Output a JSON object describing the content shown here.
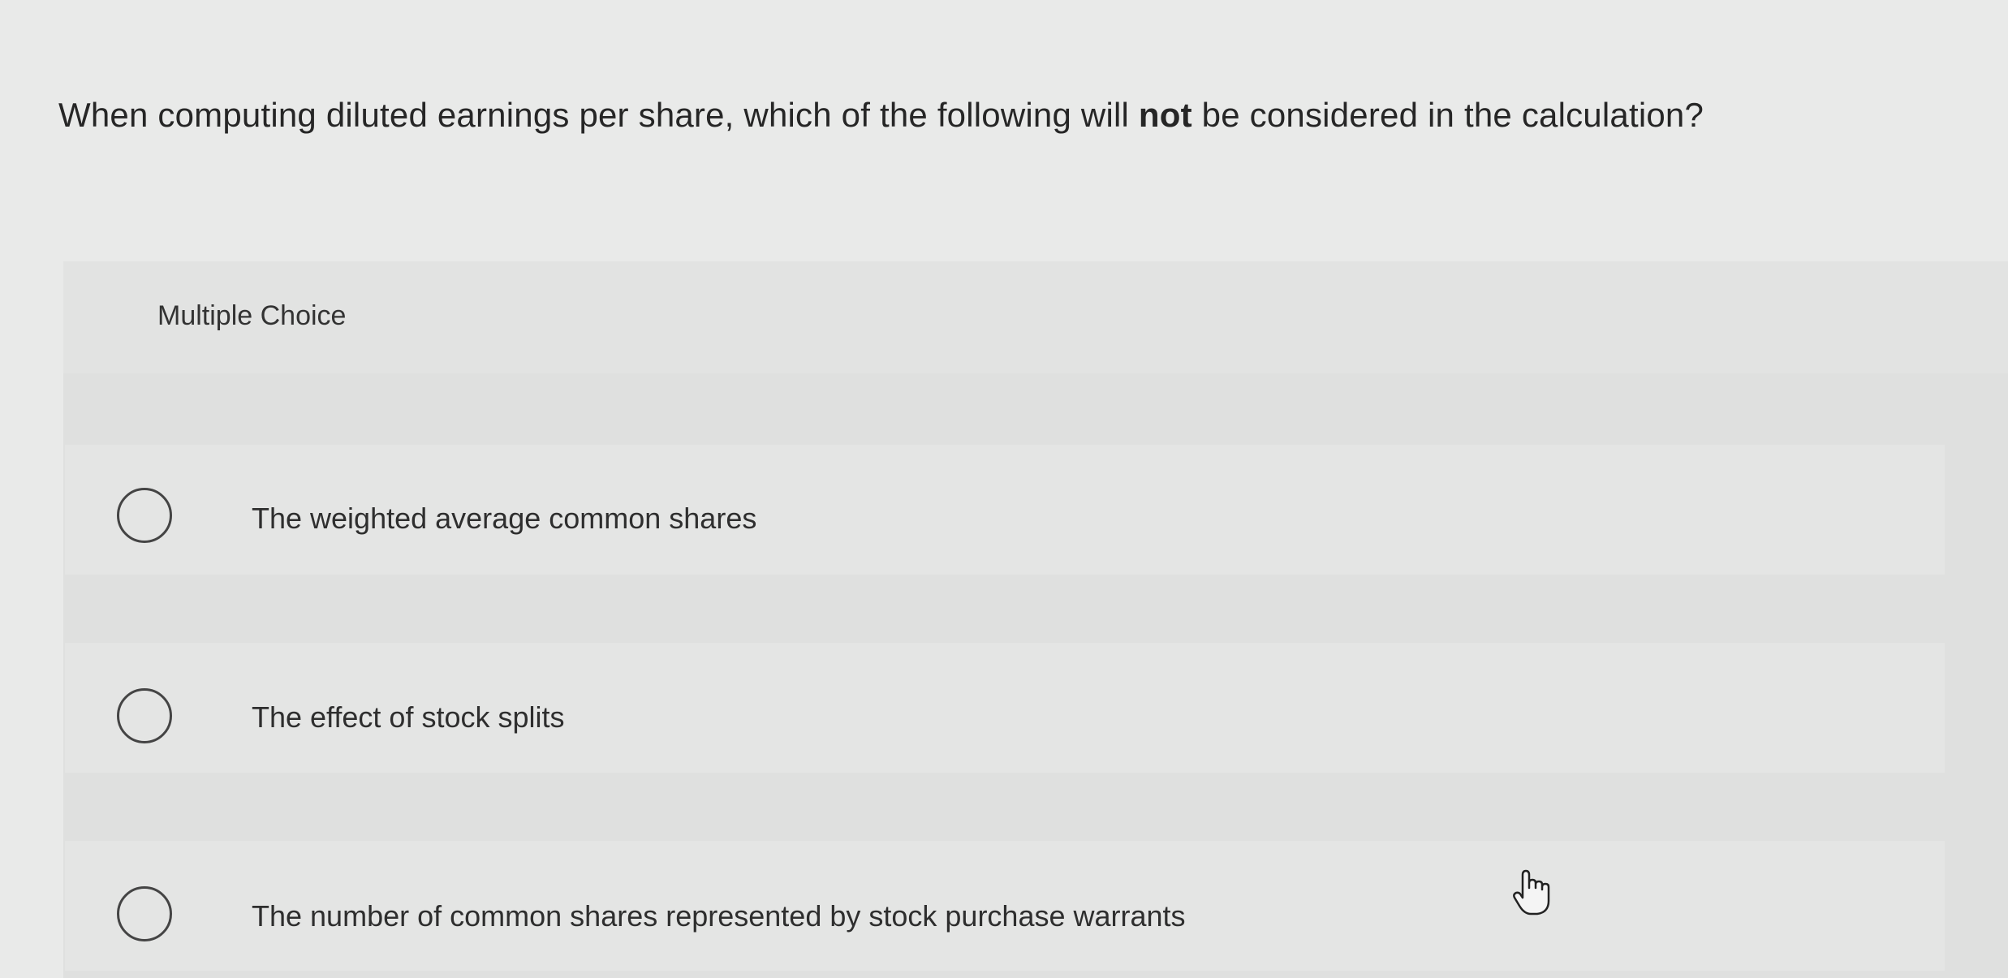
{
  "question": {
    "before": "When computing diluted earnings per share, which of the following will ",
    "emphasis": "not",
    "after": " be considered in the calculation?"
  },
  "multiple_choice_label": "Multiple Choice",
  "options": [
    {
      "label": "The weighted average common shares",
      "selected": false
    },
    {
      "label": "The effect of stock splits",
      "selected": false
    },
    {
      "label": "The number of common shares represented by stock purchase warrants",
      "selected": false
    }
  ],
  "cursor_icon": "hand-pointer-icon"
}
